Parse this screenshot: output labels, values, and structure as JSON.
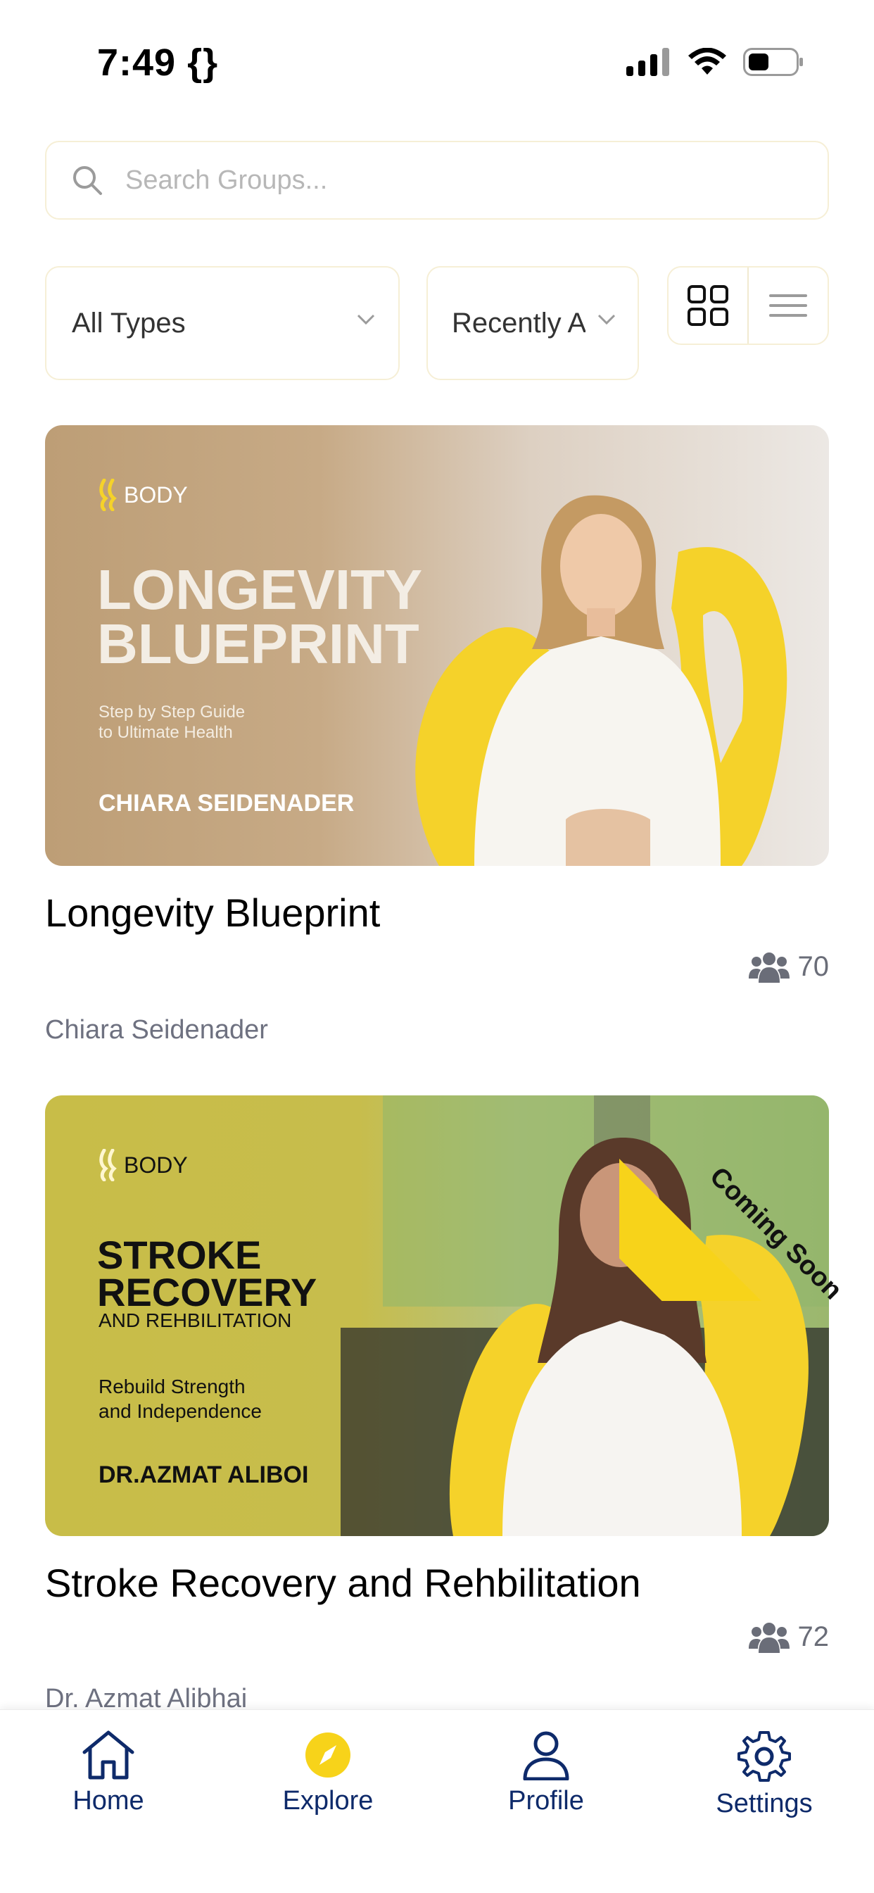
{
  "status": {
    "time": "7:49 {}"
  },
  "search": {
    "placeholder": "Search Groups..."
  },
  "filters": {
    "type_value": "All Types",
    "sort_value": "Recently A"
  },
  "groups": [
    {
      "banner": {
        "brand": "BODY",
        "title_line1": "LONGEVITY",
        "title_line2": "BLUEPRINT",
        "subtitle_line1": "Step by Step Guide",
        "subtitle_line2": "to Ultimate Health",
        "name": "CHIARA SEIDENADER"
      },
      "title": "Longevity Blueprint",
      "members": "70",
      "author": "Chiara Seidenader"
    },
    {
      "banner": {
        "brand": "BODY",
        "title_line1": "STROKE",
        "title_line2": "RECOVERY",
        "subtitle": "AND REHBILITATION",
        "tagline_line1": "Rebuild Strength",
        "tagline_line2": "and Independence",
        "name": "DR.AZMAT ALIBOI"
      },
      "badge": "Coming Soon",
      "title": "Stroke Recovery and Rehbilitation",
      "members": "72",
      "author": "Dr. Azmat Alibhai"
    }
  ],
  "tabbar": {
    "home": "Home",
    "explore": "Explore",
    "profile": "Profile",
    "settings": "Settings",
    "active": "explore"
  },
  "colors": {
    "accent": "#f7d31a",
    "nav": "#0e2a6a",
    "muted": "#6e7180"
  }
}
